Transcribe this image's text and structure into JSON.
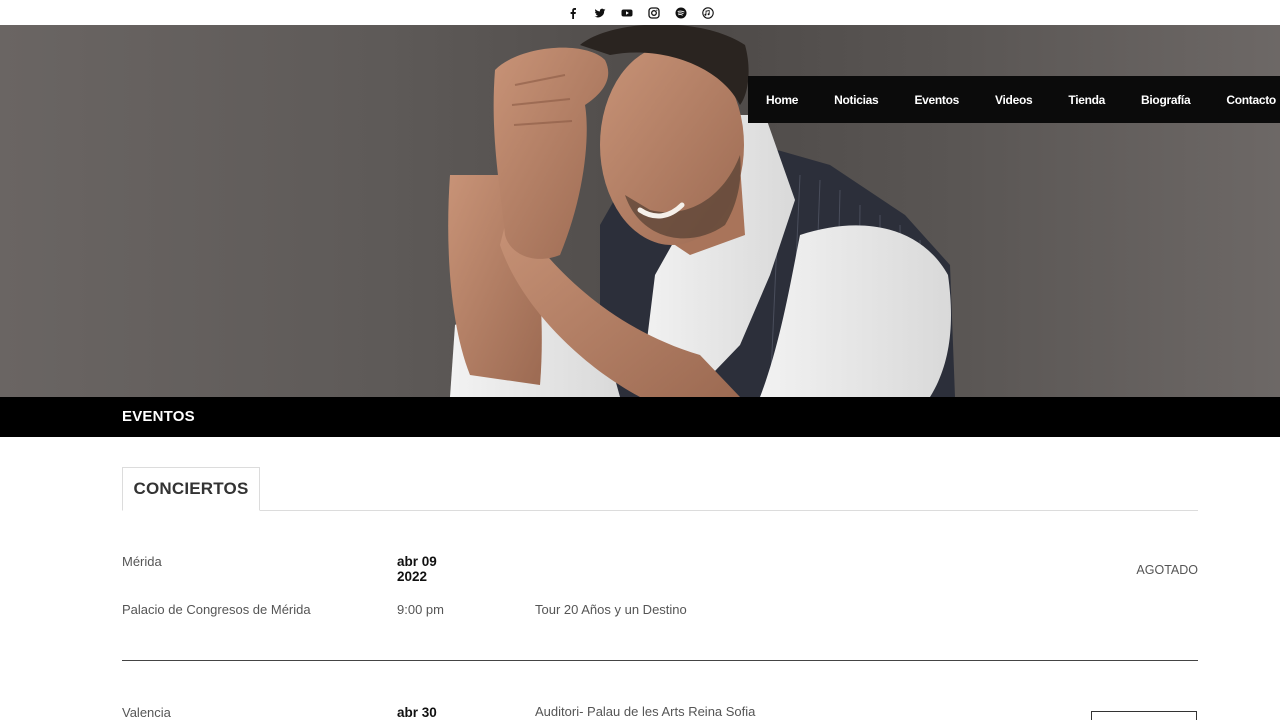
{
  "social": [
    {
      "icon": "facebook-icon"
    },
    {
      "icon": "twitter-icon"
    },
    {
      "icon": "youtube-icon"
    },
    {
      "icon": "instagram-icon"
    },
    {
      "icon": "spotify-icon"
    },
    {
      "icon": "itunes-icon"
    }
  ],
  "nav": {
    "items": [
      "Home",
      "Noticias",
      "Eventos",
      "Videos",
      "Tienda",
      "Biografía",
      "Contacto"
    ]
  },
  "section": {
    "title": "EVENTOS"
  },
  "tabs": {
    "active": "CONCIERTOS"
  },
  "events": [
    {
      "city": "Mérida",
      "date_line1": "abr 09",
      "date_line2": "2022",
      "status": "AGOTADO",
      "venue": "Palacio de Congresos de Mérida",
      "time": "9:00 pm",
      "tour": "Tour 20 Años y un Destino"
    },
    {
      "city": "Valencia",
      "date_line1": "abr 30",
      "venue": "Auditori- Palau de les Arts Reina Sofia"
    }
  ],
  "colors": {
    "nav_bg": "#0b0b0b",
    "section_bar_bg": "#000000",
    "text_muted": "#555555"
  }
}
